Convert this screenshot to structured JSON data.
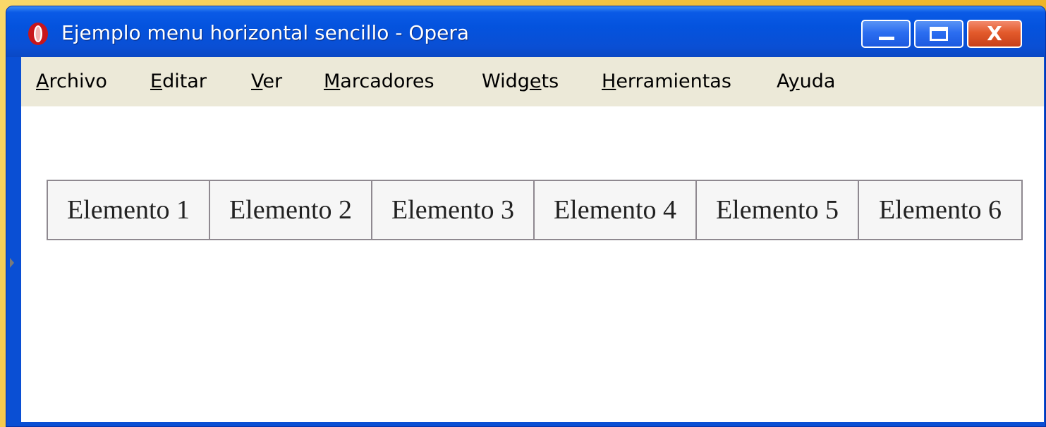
{
  "window": {
    "title": "Ejemplo menu horizontal sencillo - Opera",
    "icon": "opera-icon",
    "controls": {
      "minimize_icon": "minimize-icon",
      "maximize_icon": "maximize-icon",
      "close_label": "X"
    }
  },
  "menubar": {
    "items": [
      {
        "prefix": "",
        "accel": "A",
        "rest": "rchivo"
      },
      {
        "prefix": "",
        "accel": "E",
        "rest": "ditar"
      },
      {
        "prefix": "",
        "accel": "V",
        "rest": "er"
      },
      {
        "prefix": "",
        "accel": "M",
        "rest": "arcadores"
      },
      {
        "prefix": "Widg",
        "accel": "e",
        "rest": "ts"
      },
      {
        "prefix": "",
        "accel": "H",
        "rest": "erramientas"
      },
      {
        "prefix": "A",
        "accel": "y",
        "rest": "uda"
      }
    ]
  },
  "content": {
    "menu": [
      "Elemento 1",
      "Elemento 2",
      "Elemento 3",
      "Elemento 4",
      "Elemento 5",
      "Elemento 6"
    ]
  },
  "colors": {
    "titlebar": "#0a4fd4",
    "close_button": "#e35a2b",
    "menubar": "#ece9d8",
    "table_border": "#8f8990"
  }
}
